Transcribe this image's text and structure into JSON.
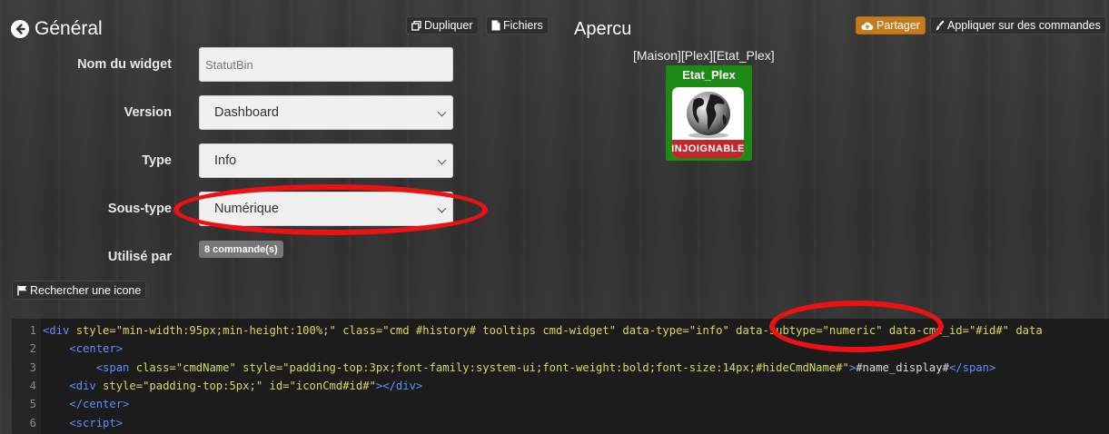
{
  "header": {
    "title": "Général",
    "duplicate_label": "Dupliquer",
    "files_label": "Fichiers",
    "preview_title": "Apercu",
    "share_label": "Partager",
    "apply_label": "Appliquer sur des commandes"
  },
  "form": {
    "widget_name_label": "Nom du widget",
    "widget_name_value": "StatutBin",
    "version_label": "Version",
    "version_value": "Dashboard",
    "type_label": "Type",
    "type_value": "Info",
    "subtype_label": "Sous-type",
    "subtype_value": "Numérique",
    "used_by_label": "Utilisé par",
    "used_by_badge": "8 commande(s)",
    "search_icon_label": "Rechercher une icone"
  },
  "preview": {
    "path": "[Maison][Plex][Etat_Plex]",
    "widget_title": "Etat_Plex",
    "status_banner": "INJOIGNABLE",
    "tile_color": "#1e8a16",
    "banner_color": "#c0282c"
  },
  "annotation_color": "#ee1111",
  "code": {
    "lines": [
      {
        "n": "1",
        "parts": [
          {
            "c": "tg",
            "t": "<div "
          },
          {
            "c": "at",
            "t": "style="
          },
          {
            "c": "st",
            "t": "\"min-width:95px;min-height:100%;\" "
          },
          {
            "c": "at",
            "t": "class="
          },
          {
            "c": "st",
            "t": "\"cmd #history# tooltips cmd-widget\" "
          },
          {
            "c": "at",
            "t": "data-type="
          },
          {
            "c": "st",
            "t": "\"info\" "
          },
          {
            "c": "at",
            "t": "data-subtype="
          },
          {
            "c": "st",
            "t": "\"numeric\" "
          },
          {
            "c": "at",
            "t": "data-cmd_id="
          },
          {
            "c": "st",
            "t": "\"#id#\" "
          },
          {
            "c": "at",
            "t": "data"
          }
        ]
      },
      {
        "n": "2",
        "parts": [
          {
            "c": "tx",
            "t": "    "
          },
          {
            "c": "tg",
            "t": "<center>"
          }
        ]
      },
      {
        "n": "3",
        "parts": [
          {
            "c": "tx",
            "t": "        "
          },
          {
            "c": "tg",
            "t": "<span "
          },
          {
            "c": "at",
            "t": "class="
          },
          {
            "c": "st",
            "t": "\"cmdName\" "
          },
          {
            "c": "at",
            "t": "style="
          },
          {
            "c": "st",
            "t": "\"padding-top:3px;font-family:system-ui;font-weight:bold;font-size:14px;#hideCmdName#\""
          },
          {
            "c": "tg",
            "t": ">"
          },
          {
            "c": "tx",
            "t": "#name_display#"
          },
          {
            "c": "tg",
            "t": "</span>"
          }
        ]
      },
      {
        "n": "4",
        "parts": [
          {
            "c": "tx",
            "t": "    "
          },
          {
            "c": "tg",
            "t": "<div "
          },
          {
            "c": "at",
            "t": "style="
          },
          {
            "c": "st",
            "t": "\"padding-top:5px;\" "
          },
          {
            "c": "at",
            "t": "id="
          },
          {
            "c": "st",
            "t": "\"iconCmd#id#\""
          },
          {
            "c": "tg",
            "t": "></div>"
          }
        ]
      },
      {
        "n": "5",
        "parts": [
          {
            "c": "tx",
            "t": "    "
          },
          {
            "c": "tg",
            "t": "</center>"
          }
        ]
      },
      {
        "n": "6",
        "parts": [
          {
            "c": "tx",
            "t": "    "
          },
          {
            "c": "tg",
            "t": "<script>"
          }
        ]
      }
    ]
  }
}
